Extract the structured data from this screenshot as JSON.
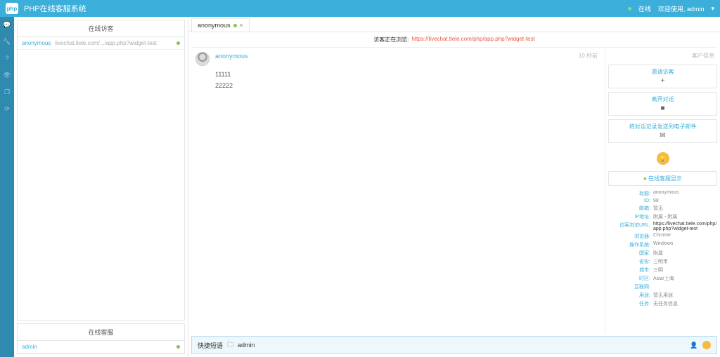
{
  "header": {
    "title": "PHP在线客服系统",
    "status_label": "在线",
    "welcome_prefix": "欢迎使用,",
    "username": "admin",
    "logout_symbol": "▾"
  },
  "sidebar_icons": [
    "comments",
    "wrench",
    "question",
    "eye",
    "copy",
    "refresh"
  ],
  "left": {
    "visitors_title": "在线访客",
    "agents_title": "在线客服",
    "visitor": {
      "name": "anonymous",
      "url": "livechat.tiele.com/.../app.php?widget-test"
    },
    "agent": {
      "name": "admin"
    }
  },
  "tabs": [
    {
      "label": "anonymous"
    }
  ],
  "url_bar": {
    "label": "访客正在浏览:",
    "url": "https://livechat.tiele.com/php/app.php?widget-test"
  },
  "chat": {
    "name": "anonymous",
    "time": "10 秒前",
    "messages": [
      "11111",
      "22222"
    ]
  },
  "right": {
    "tab_label": "客户信息",
    "actions": {
      "invite": "邀请访客",
      "invite_sub": "+",
      "leave": "离开对话",
      "leave_sub": "■",
      "email": "将对话记录发送到电子邮件",
      "email_sub": "✉"
    },
    "show_note": "在线客服显示",
    "info": [
      {
        "k": "标题:",
        "v": "anonymous"
      },
      {
        "k": "ID:",
        "v": "98"
      },
      {
        "k": "邮箱:",
        "v": "暂无"
      },
      {
        "k": "IP地址:",
        "v": "附属 - 附属"
      },
      {
        "k": "访客浏览URL:",
        "v": "https://livechat.tiele.com/php/app.php?widget-test",
        "dark": true
      },
      {
        "k": "浏览器:",
        "v": "Chrome"
      },
      {
        "k": "操作系统:",
        "v": "Windows"
      },
      {
        "k": "国家:",
        "v": "附属"
      },
      {
        "k": "省份:",
        "v": "三明市"
      },
      {
        "k": "城市:",
        "v": "三明"
      },
      {
        "k": "时区:",
        "v": "Asia/上海"
      },
      {
        "k": "互联网:",
        "v": ""
      },
      {
        "k": "用途:",
        "v": "暂无用途"
      },
      {
        "k": "任务:",
        "v": "无任务信息"
      }
    ]
  },
  "bottom": {
    "label": "快捷短语",
    "folder": "admin"
  }
}
